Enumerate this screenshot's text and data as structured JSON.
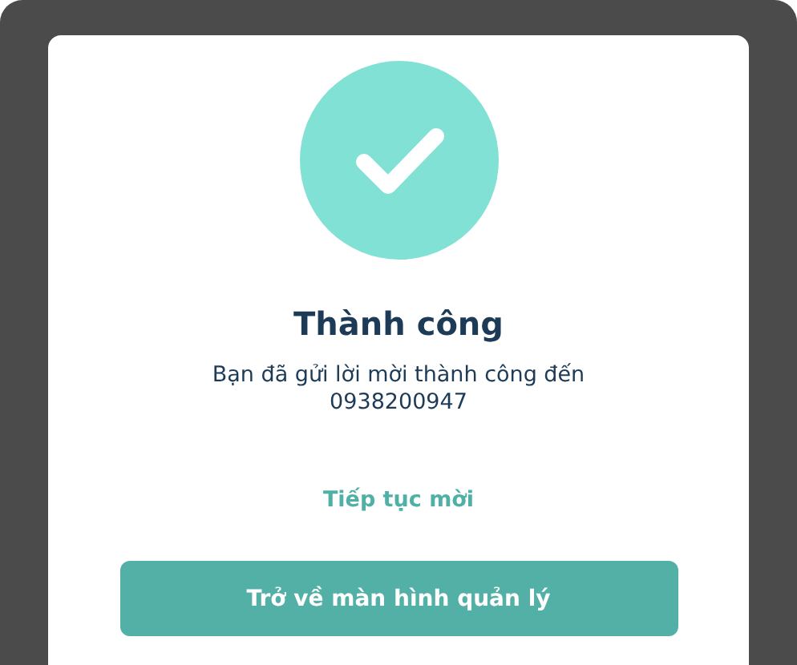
{
  "dialog": {
    "status": {
      "kind": "success"
    },
    "title": "Thành công",
    "message": "Bạn đã gửi lời mời thành công đến 0938200947",
    "link": "Tiếp tục mời",
    "button": "Trở về màn hình quản lý"
  }
}
